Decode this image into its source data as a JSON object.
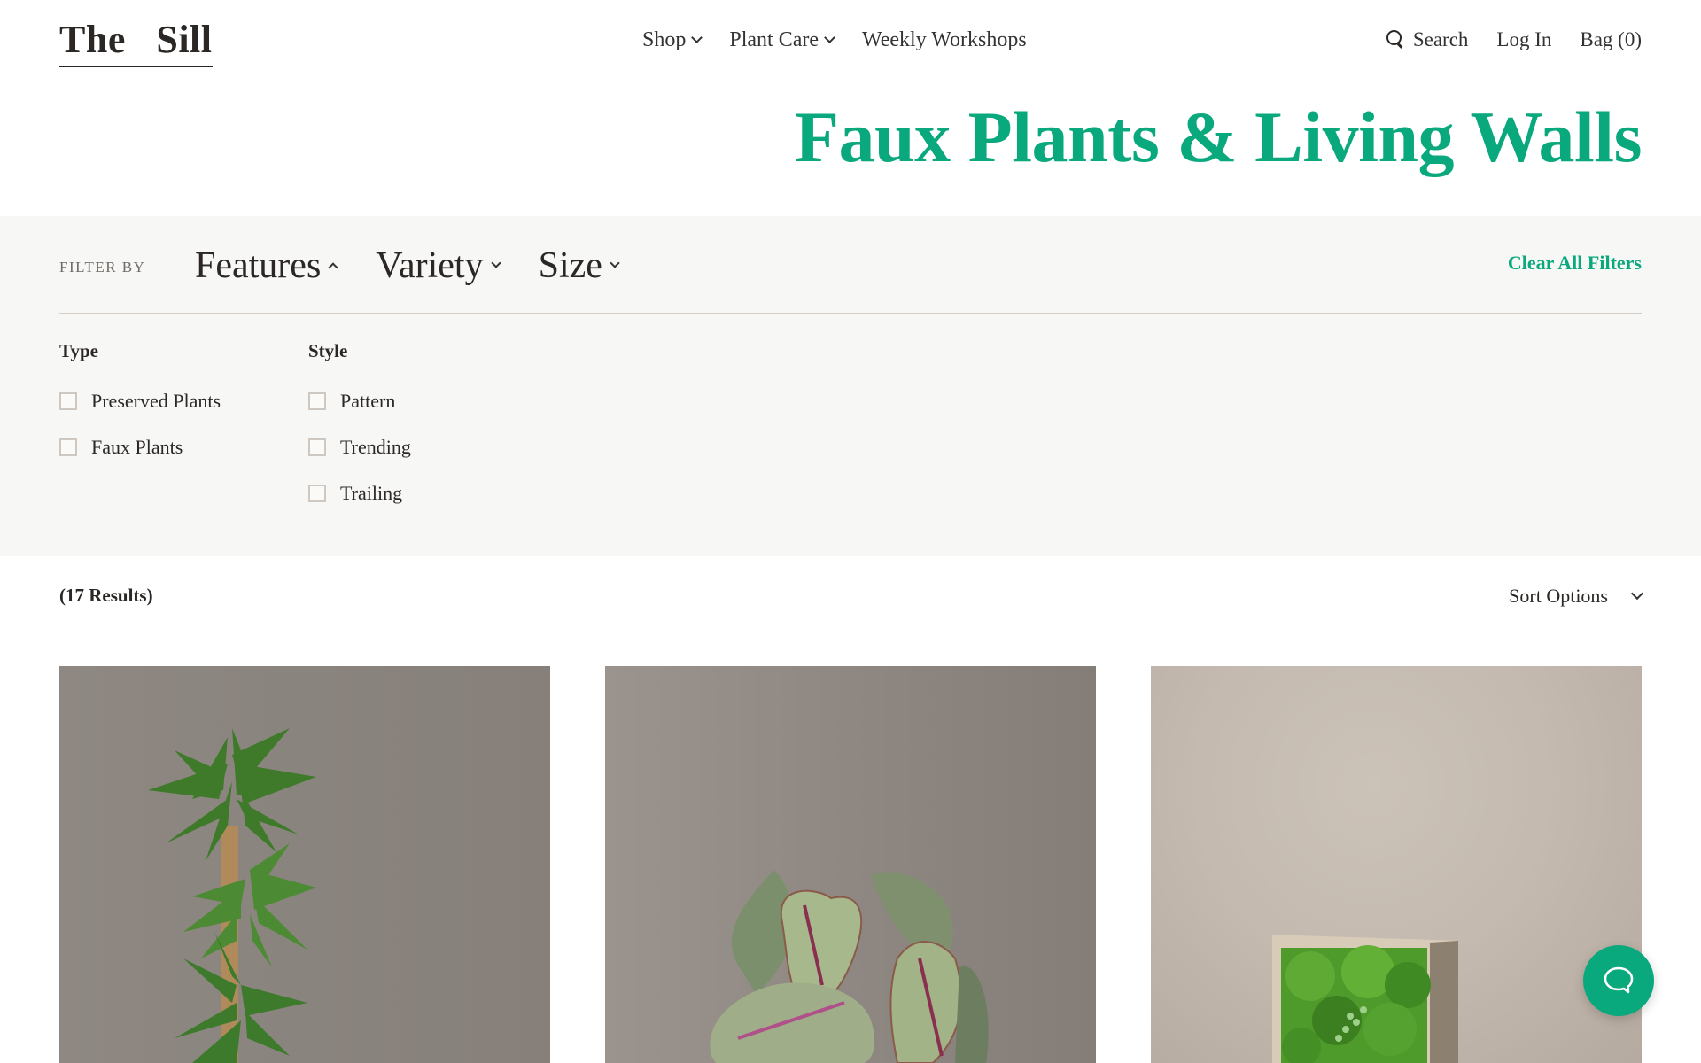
{
  "header": {
    "logo": "The   Sill",
    "nav": [
      {
        "label": "Shop",
        "has_dropdown": true
      },
      {
        "label": "Plant Care",
        "has_dropdown": true
      },
      {
        "label": "Weekly Workshops",
        "has_dropdown": false
      }
    ],
    "utility": {
      "search_label": "Search",
      "login_label": "Log In",
      "bag_label": "Bag (0)"
    }
  },
  "page_title": "Faux Plants & Living Walls",
  "filters": {
    "filter_by_label": "FILTER BY",
    "tabs": [
      {
        "label": "Features",
        "expanded": true
      },
      {
        "label": "Variety",
        "expanded": false
      },
      {
        "label": "Size",
        "expanded": false
      }
    ],
    "clear_all_label": "Clear All Filters",
    "groups": [
      {
        "heading": "Type",
        "options": [
          {
            "label": "Preserved Plants",
            "checked": false
          },
          {
            "label": "Faux Plants",
            "checked": false
          }
        ]
      },
      {
        "heading": "Style",
        "options": [
          {
            "label": "Pattern",
            "checked": false
          },
          {
            "label": "Trending",
            "checked": false
          },
          {
            "label": "Trailing",
            "checked": false
          }
        ]
      }
    ]
  },
  "results": {
    "count_label": "(17 Results)",
    "sort_label": "Sort Options"
  },
  "products": [
    {
      "image": "faux dracaena tree on cane against grey backdrop"
    },
    {
      "image": "faux rex begonia with pink and green leaves against grey backdrop"
    },
    {
      "image": "preserved moss living wall in wooden frame against beige backdrop"
    }
  ],
  "colors": {
    "brand_green": "#0aa87d",
    "text_dark": "#2b2724",
    "panel_bg": "#f7f7f5",
    "divider": "#d4cec7"
  },
  "chat": {
    "icon": "chat-bubble-icon"
  }
}
